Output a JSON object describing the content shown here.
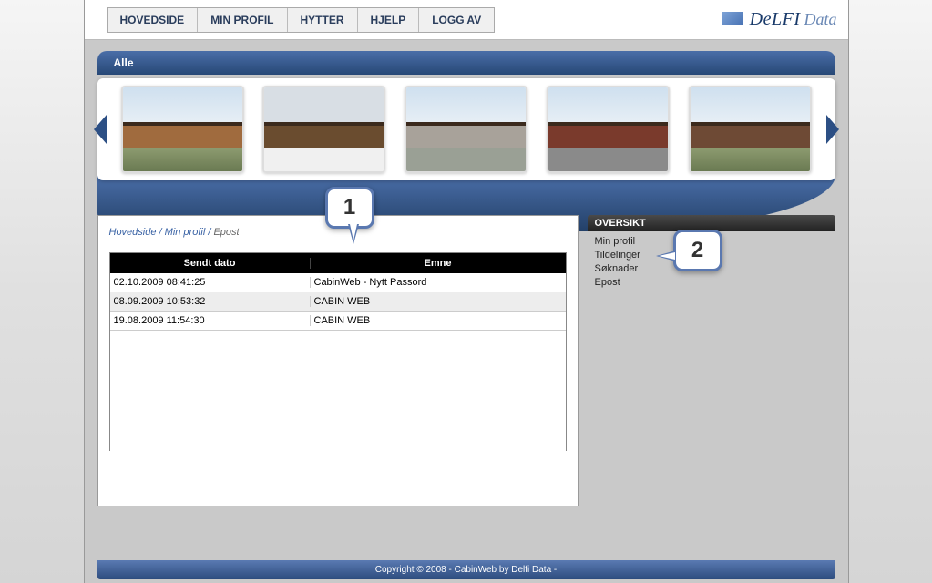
{
  "nav": {
    "items": [
      "HOVEDSIDE",
      "MIN PROFIL",
      "HYTTER",
      "HJELP",
      "LOGG AV"
    ]
  },
  "logo": {
    "brand1": "DeLFI",
    "brand2": "Data"
  },
  "bluebar_label": "Alle",
  "breadcrumb": {
    "home": "Hovedside",
    "profile": "Min profil",
    "current": "Epost",
    "sep": " / "
  },
  "table": {
    "headers": {
      "sent": "Sendt dato",
      "subject": "Emne"
    },
    "rows": [
      {
        "date": "02.10.2009 08:41:25",
        "subject": "CabinWeb - Nytt Passord"
      },
      {
        "date": "08.09.2009 10:53:32",
        "subject": "CABIN WEB"
      },
      {
        "date": "19.08.2009 11:54:30",
        "subject": "CABIN WEB"
      }
    ]
  },
  "oversikt": {
    "header": "OVERSIKT",
    "links": [
      "Min profil",
      "Tildelinger",
      "Søknader",
      "Epost"
    ]
  },
  "callouts": {
    "one": "1",
    "two": "2"
  },
  "footer": "Copyright © 2008 - CabinWeb by Delfi Data -"
}
